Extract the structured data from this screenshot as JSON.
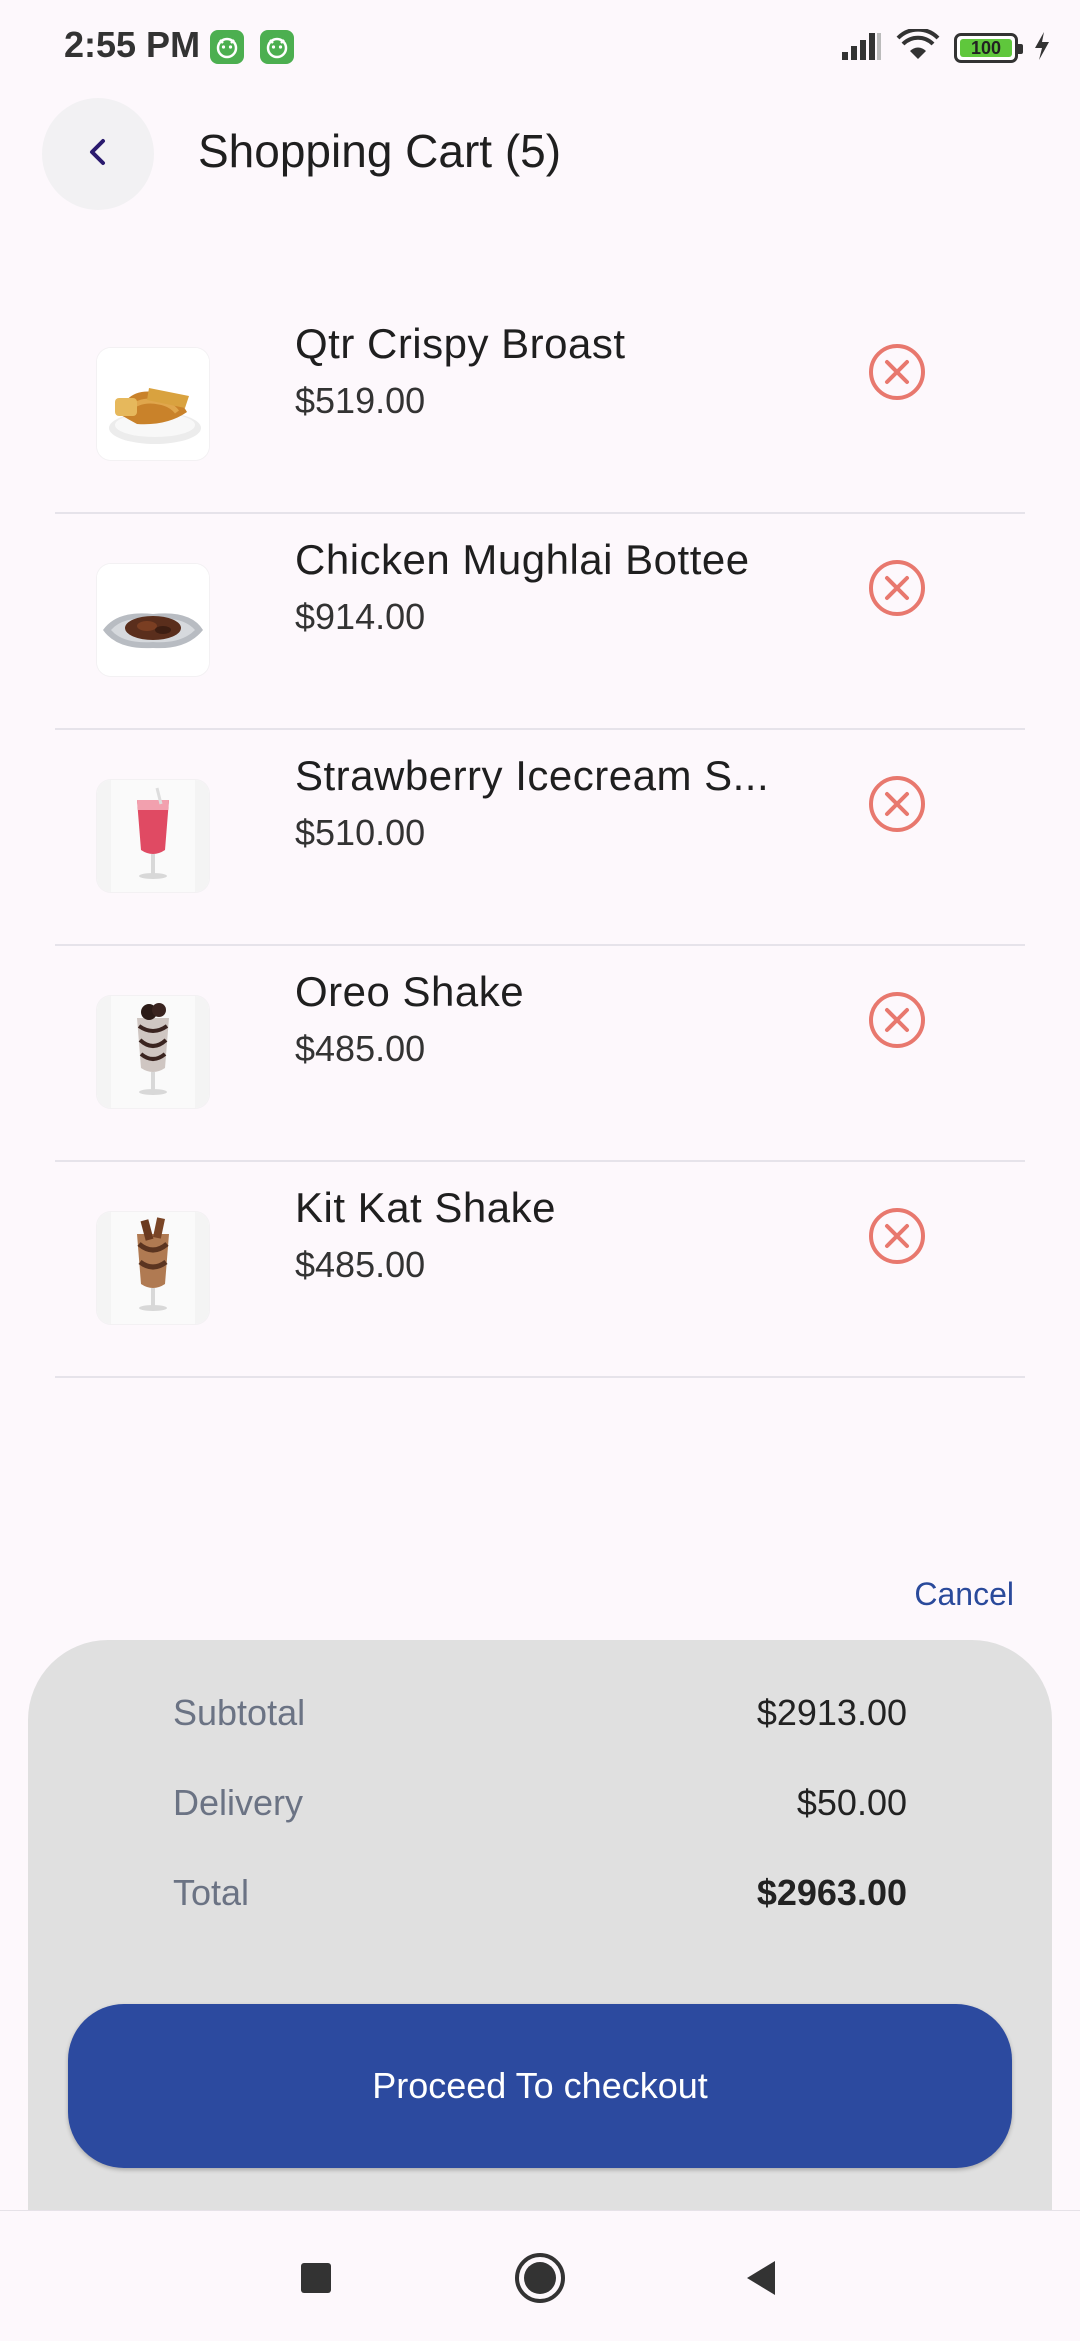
{
  "status_bar": {
    "time": "2:55 PM",
    "battery_level": "100",
    "icons": [
      "notification-app-icon",
      "notification-app-icon",
      "signal-icon",
      "wifi-icon",
      "battery-icon",
      "charging-icon"
    ]
  },
  "header": {
    "title": "Shopping Cart (5)",
    "back_icon": "chevron-left-icon"
  },
  "cart": {
    "items": [
      {
        "name": "Qtr Crispy Broast",
        "price": "$519.00",
        "image": "fried-chicken-plate"
      },
      {
        "name": "Chicken Mughlai Bottee",
        "price": "$914.00",
        "image": "chicken-foil-tray"
      },
      {
        "name": "Strawberry Icecream S...",
        "price": "$510.00",
        "image": "strawberry-shake-glass"
      },
      {
        "name": "Oreo Shake",
        "price": "$485.00",
        "image": "oreo-shake-glass"
      },
      {
        "name": "Kit Kat Shake",
        "price": "$485.00",
        "image": "kitkat-shake-glass"
      }
    ],
    "remove_icon": "remove-circle-x-icon"
  },
  "cancel_label": "Cancel",
  "summary": {
    "subtotal_label": "Subtotal",
    "subtotal_value": "$2913.00",
    "delivery_label": "Delivery",
    "delivery_value": "$50.00",
    "total_label": "Total",
    "total_value": "$2963.00",
    "checkout_label": "Proceed To checkout"
  },
  "colors": {
    "accent": "#2c4a9f",
    "remove": "#e8786e",
    "background": "#fdf8fc",
    "panel": "#e0e0e0"
  },
  "nav": {
    "icons": [
      "square-recents-icon",
      "circle-home-icon",
      "triangle-back-icon"
    ]
  }
}
